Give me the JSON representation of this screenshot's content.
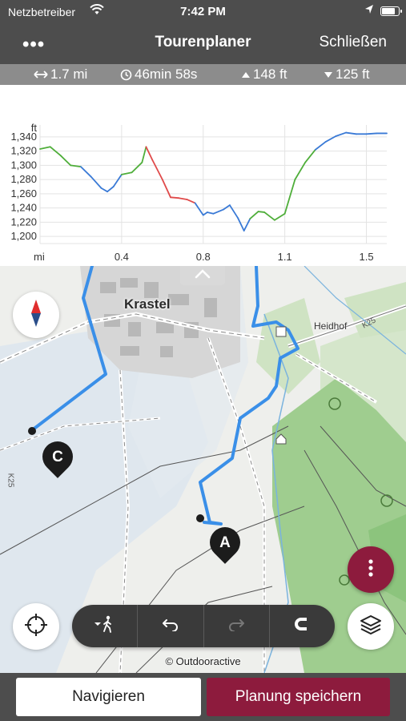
{
  "status_bar": {
    "carrier": "Netzbetreiber",
    "time": "7:42 PM",
    "battery_level": 0.85
  },
  "nav": {
    "menu_label": "•••",
    "title": "Tourenplaner",
    "close_label": "Schließen"
  },
  "stats": {
    "distance": "1.7 mi",
    "duration": "46min 58s",
    "ascent": "148 ft",
    "descent": "125 ft"
  },
  "chart_data": {
    "type": "line",
    "ylabel": "ft",
    "xlabel": "mi",
    "ylim": [
      1190,
      1350
    ],
    "xlim": [
      0,
      1.7
    ],
    "yticks": [
      "1,340",
      "1,320",
      "1,300",
      "1,280",
      "1,260",
      "1,240",
      "1,220",
      "1,200"
    ],
    "ytick_values": [
      1340,
      1320,
      1300,
      1280,
      1260,
      1240,
      1220,
      1200
    ],
    "xticks": [
      "0.4",
      "0.8",
      "1.1",
      "1.5"
    ],
    "xtick_values": [
      0.4,
      0.8,
      1.2,
      1.6
    ],
    "grid": true,
    "colors": {
      "up": "#4fae3a",
      "flat": "#3a7ad6",
      "steep": "#e04a4a"
    },
    "series": [
      {
        "x": [
          0.0,
          0.05,
          0.1,
          0.15,
          0.2,
          0.25,
          0.3,
          0.33,
          0.36,
          0.4,
          0.45,
          0.5,
          0.52,
          0.55,
          0.6,
          0.64,
          0.68,
          0.72,
          0.76,
          0.8,
          0.82,
          0.85,
          0.9,
          0.93,
          0.97,
          1.0,
          1.03,
          1.07,
          1.1,
          1.15,
          1.2,
          1.25,
          1.3,
          1.35,
          1.4,
          1.45,
          1.5,
          1.55,
          1.6,
          1.65,
          1.7
        ],
        "y": [
          1323,
          1326,
          1314,
          1300,
          1298,
          1284,
          1268,
          1263,
          1270,
          1287,
          1290,
          1304,
          1326,
          1308,
          1280,
          1255,
          1254,
          1252,
          1247,
          1230,
          1234,
          1232,
          1238,
          1244,
          1226,
          1208,
          1225,
          1235,
          1234,
          1223,
          1232,
          1280,
          1304,
          1322,
          1333,
          1341,
          1346,
          1344,
          1344,
          1345,
          1345
        ],
        "segments": [
          "up",
          "up",
          "up",
          "up",
          "flat",
          "flat",
          "flat",
          "flat",
          "flat",
          "up",
          "up",
          "up",
          "steep",
          "steep",
          "steep",
          "steep",
          "steep",
          "steep",
          "flat",
          "flat",
          "flat",
          "flat",
          "flat",
          "flat",
          "flat",
          "flat",
          "up",
          "up",
          "up",
          "up",
          "up",
          "up",
          "up",
          "flat",
          "flat",
          "flat",
          "flat",
          "flat",
          "flat",
          "flat"
        ]
      }
    ]
  },
  "map": {
    "town": "Krastel",
    "village": "Heidhof",
    "road_k25": "K25",
    "road_k25_b": "K25",
    "copyright": "© Outdooractive",
    "marker_a": "A",
    "marker_c": "C",
    "route_color": "#3a8fe8"
  },
  "toolbar": {
    "mode_icon": "hiker-icon",
    "undo_icon": "undo-icon",
    "redo_icon": "redo-icon",
    "magnet_icon": "magnet-icon"
  },
  "buttons": {
    "navigate": "Navigieren",
    "save": "Planung speichern"
  },
  "accent_color": "#8d1b3d"
}
